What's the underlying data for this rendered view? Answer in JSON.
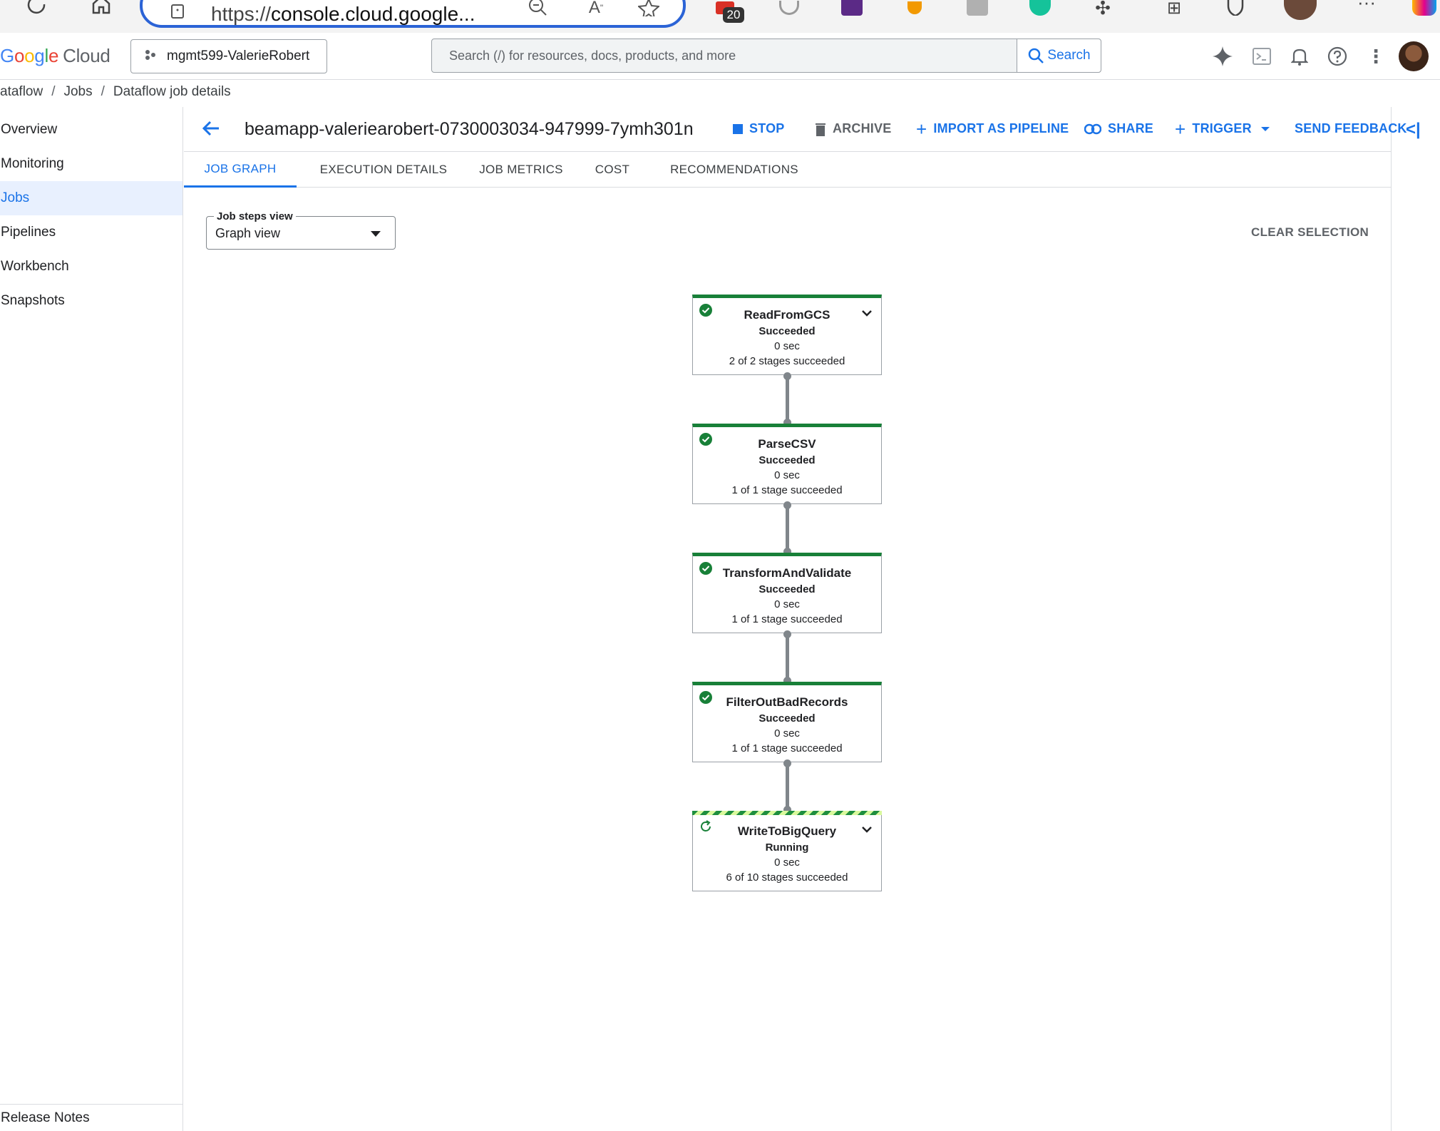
{
  "browser": {
    "url": "https://console.cloud.google...",
    "url_scheme": "https://",
    "url_host": "console.cloud.google...",
    "extension_badge": "20"
  },
  "header": {
    "logo_google": "Google",
    "logo_cloud": "Cloud",
    "project": "mgmt599-ValerieRobert",
    "search_placeholder": "Search (/) for resources, docs, products, and more",
    "search_button": "Search"
  },
  "breadcrumb": {
    "items": [
      "ataflow",
      "Jobs",
      "Dataflow job details"
    ],
    "separator": "/"
  },
  "sidebar": {
    "items": [
      {
        "label": "Overview"
      },
      {
        "label": "Monitoring"
      },
      {
        "label": "Jobs"
      },
      {
        "label": "Pipelines"
      },
      {
        "label": "Workbench"
      },
      {
        "label": "Snapshots"
      }
    ],
    "active": "Jobs",
    "footer": "Release Notes"
  },
  "job": {
    "title": "beamapp-valeriearobert-0730003034-947999-7ymh301n",
    "actions": {
      "stop": "STOP",
      "archive": "ARCHIVE",
      "import": "IMPORT AS PIPELINE",
      "share": "SHARE",
      "trigger": "TRIGGER",
      "feedback": "SEND FEEDBACK"
    }
  },
  "tabs": [
    {
      "label": "JOB GRAPH",
      "active": true
    },
    {
      "label": "EXECUTION DETAILS"
    },
    {
      "label": "JOB METRICS"
    },
    {
      "label": "COST"
    },
    {
      "label": "RECOMMENDATIONS"
    }
  ],
  "steps_view": {
    "label": "Job steps view",
    "value": "Graph view",
    "clear_selection": "CLEAR SELECTION"
  },
  "graph": {
    "nodes": [
      {
        "name": "ReadFromGCS",
        "status": "Succeeded",
        "duration": "0 sec",
        "stages": "2 of 2 stages succeeded",
        "expandable": true
      },
      {
        "name": "ParseCSV",
        "status": "Succeeded",
        "duration": "0 sec",
        "stages": "1 of 1 stage succeeded",
        "expandable": false
      },
      {
        "name": "TransformAndValidate",
        "status": "Succeeded",
        "duration": "0 sec",
        "stages": "1 of 1 stage succeeded",
        "expandable": false
      },
      {
        "name": "FilterOutBadRecords",
        "status": "Succeeded",
        "duration": "0 sec",
        "stages": "1 of 1 stage succeeded",
        "expandable": false
      },
      {
        "name": "WriteToBigQuery",
        "status": "Running",
        "duration": "0 sec",
        "stages": "6 of 10 stages succeeded",
        "expandable": true
      }
    ]
  },
  "colors": {
    "accent": "#1a73e8",
    "success": "#188038",
    "running_stripe": "#d9f99d",
    "nav_active_bg": "#e8f0fe"
  }
}
